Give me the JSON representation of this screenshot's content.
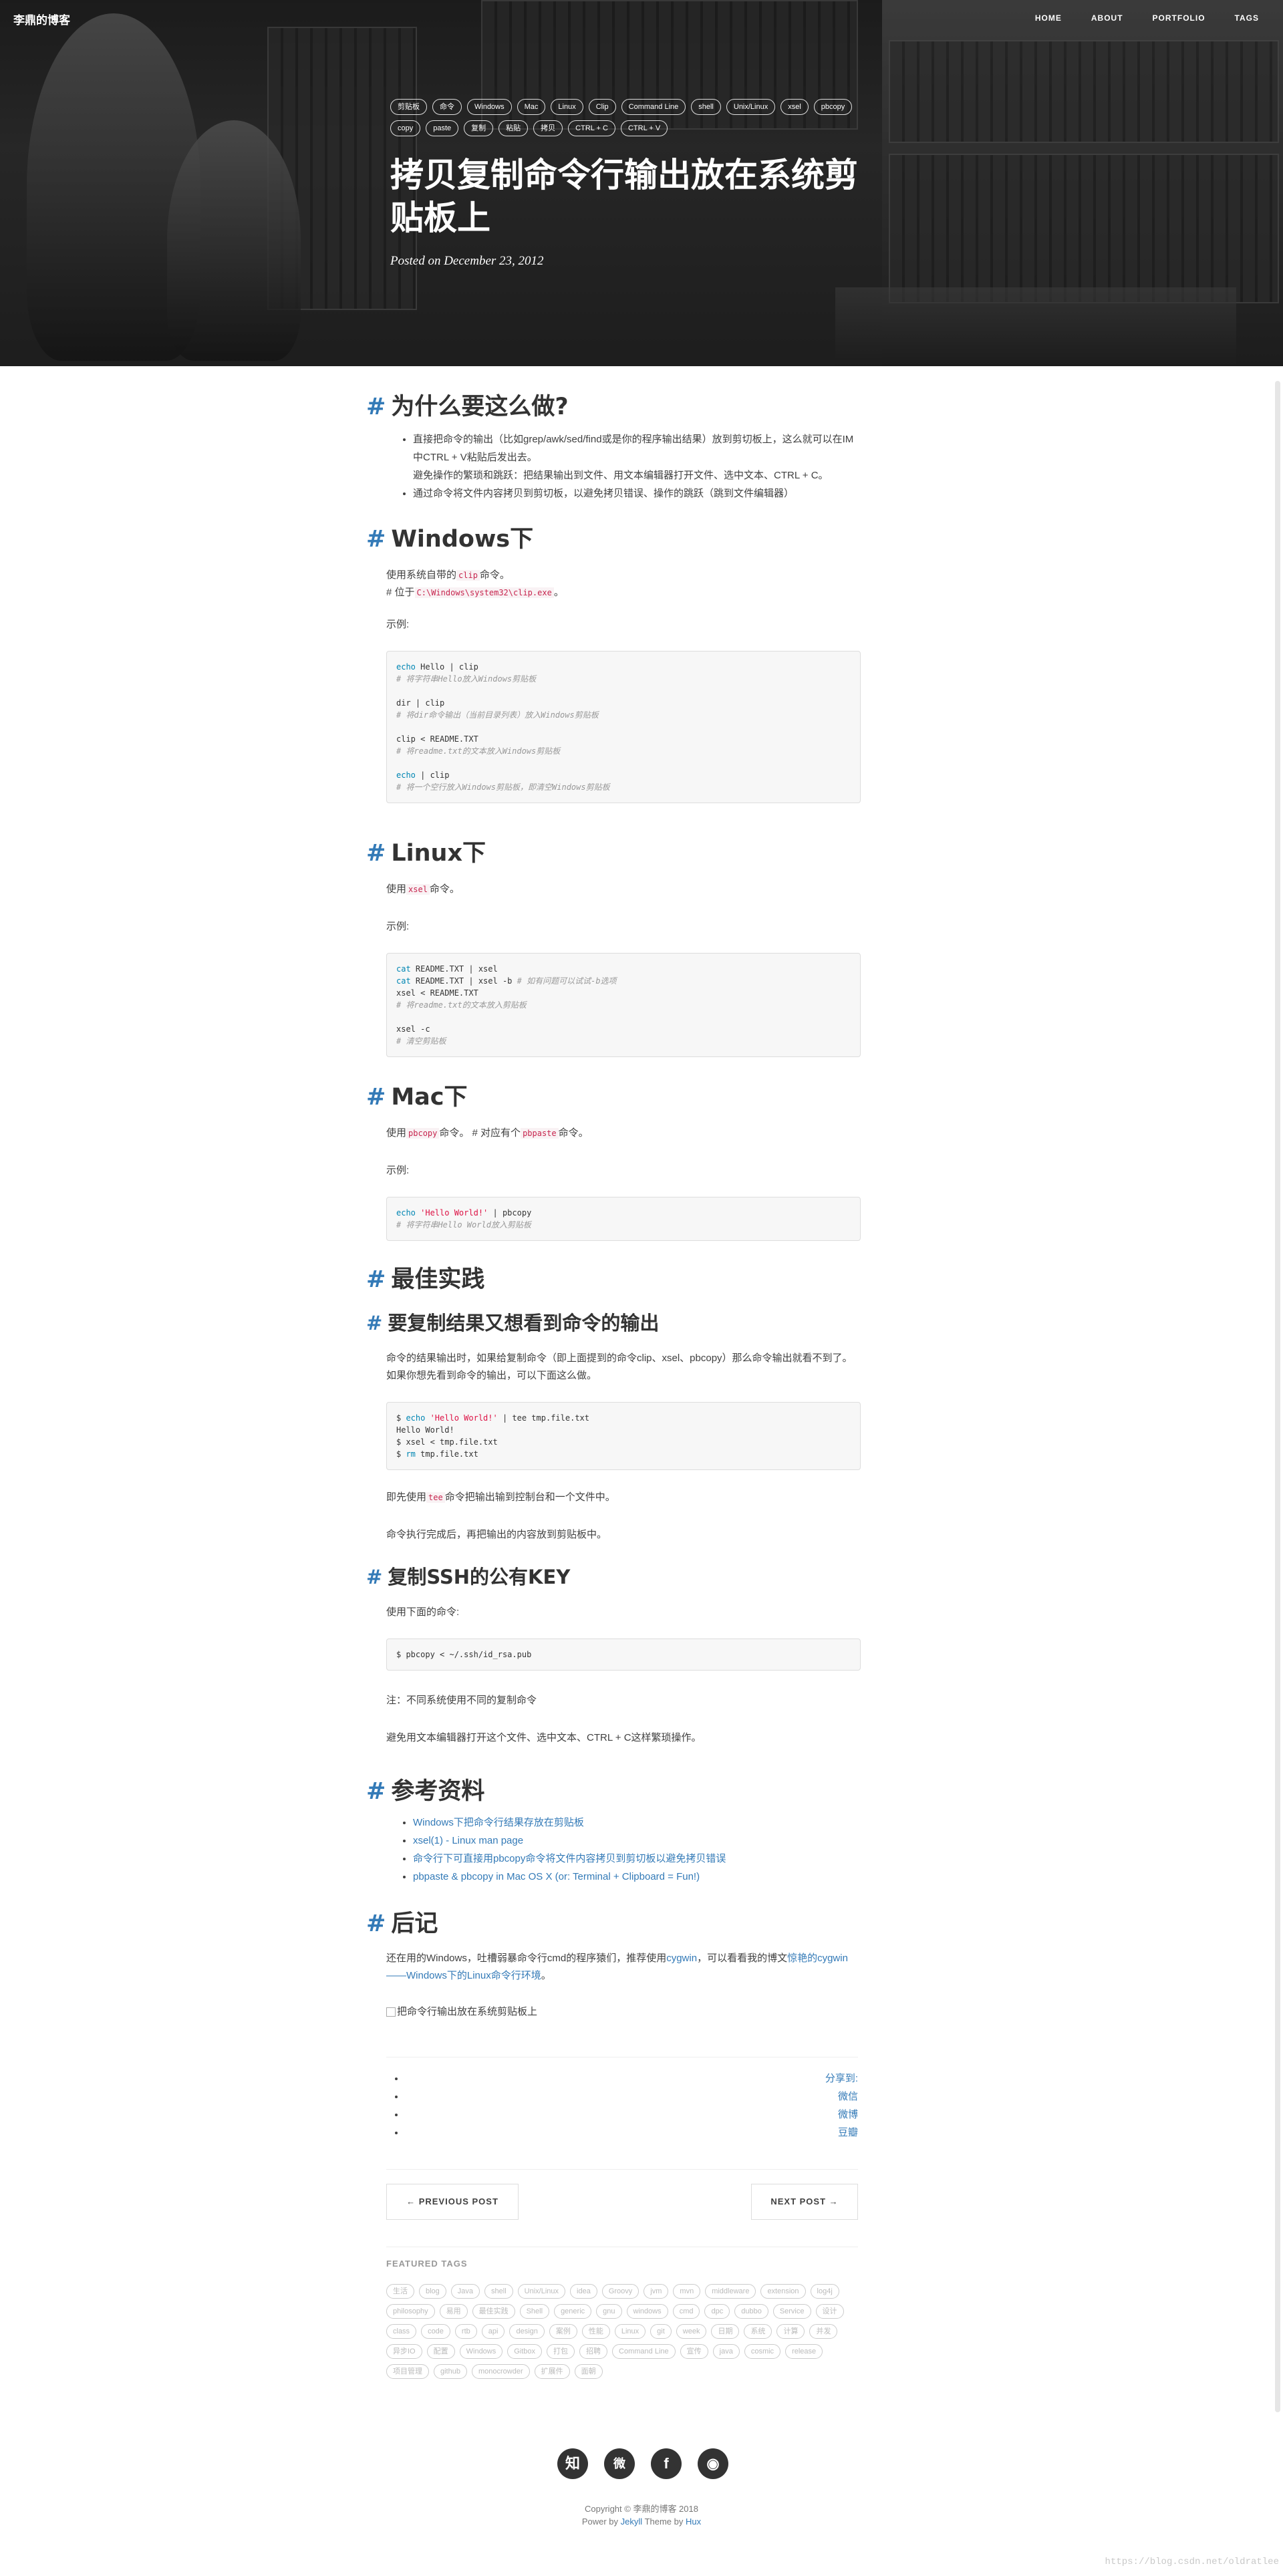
{
  "navbar": {
    "brand": "李鼎的博客",
    "links": [
      "HOME",
      "ABOUT",
      "PORTFOLIO",
      "TAGS"
    ]
  },
  "header": {
    "tags": [
      "剪贴板",
      "命令",
      "Windows",
      "Mac",
      "Linux",
      "Clip",
      "Command Line",
      "shell",
      "Unix/Linux",
      "xsel",
      "pbcopy",
      "copy",
      "paste",
      "复制",
      "粘贴",
      "拷贝",
      "CTRL + C",
      "CTRL + V"
    ],
    "title": "拷贝复制命令行输出放在系统剪贴板上",
    "meta": "Posted on December 23, 2012"
  },
  "why": {
    "heading": "为什么要这么做?",
    "b1": "直接把命令的输出（比如grep/awk/sed/find或是你的程序输出结果）放到剪切板上，这么就可以在IM中CTRL + V粘贴后发出去。",
    "b1b": "避免操作的繁琐和跳跃：把结果输出到文件、用文本编辑器打开文件、选中文本、CTRL + C。",
    "b2": "通过命令将文件内容拷贝到剪切板，以避免拷贝错误、操作的跳跃（跳到文件编辑器）"
  },
  "windows": {
    "heading": "Windows下",
    "p1a": "使用系统自带的",
    "p1code": "clip",
    "p1b": "命令。",
    "p2a": "# 位于",
    "p2code": "C:\\Windows\\system32\\clip.exe",
    "p2b": "。",
    "example": "示例:",
    "code": [
      {
        "k": "echo",
        "t": " Hello | clip"
      },
      {
        "c": "# 将字符串Hello放入Windows剪贴板"
      },
      {
        "t": ""
      },
      {
        "t": "dir | clip"
      },
      {
        "c": "# 将dir命令输出（当前目录列表）放入Windows剪贴板"
      },
      {
        "t": ""
      },
      {
        "t": "clip < README.TXT"
      },
      {
        "c": "# 将readme.txt的文本放入Windows剪贴板"
      },
      {
        "t": ""
      },
      {
        "k": "echo",
        "t": " | clip"
      },
      {
        "c": "# 将一个空行放入Windows剪贴板，即清空Windows剪贴板"
      }
    ]
  },
  "linux": {
    "heading": "Linux下",
    "p1a": "使用",
    "p1code": "xsel",
    "p1b": "命令。",
    "example": "示例:",
    "code": [
      {
        "k": "cat",
        "t": " README.TXT | xsel"
      },
      {
        "k": "cat",
        "t": " README.TXT | xsel -b ",
        "c": "# 如有问题可以试试-b选项"
      },
      {
        "t": "xsel < README.TXT"
      },
      {
        "c": "# 将readme.txt的文本放入剪贴板"
      },
      {
        "t": ""
      },
      {
        "t": "xsel -c"
      },
      {
        "c": "# 清空剪贴板"
      }
    ]
  },
  "mac": {
    "heading": "Mac下",
    "p1a": "使用",
    "p1code": "pbcopy",
    "p1b": "命令。 # 对应有个",
    "p1code2": "pbpaste",
    "p1c": "命令。",
    "example": "示例:",
    "code": [
      {
        "k": "echo",
        "s": " 'Hello World!'",
        "t": " | pbcopy"
      },
      {
        "c": "# 将字符串Hello World放入剪贴板"
      }
    ]
  },
  "best": {
    "heading": "最佳实践",
    "sub1": "要复制结果又想看到命令的输出",
    "p1": "命令的结果输出时，如果给复制命令（即上面提到的命令clip、xsel、pbcopy）那么命令输出就看不到了。如果你想先看到命令的输出，可以下面这么做。",
    "code": [
      {
        "t": "$ ",
        "k": "echo",
        "s": " 'Hello World!'",
        "t2": " | tee tmp.file.txt"
      },
      {
        "t": "Hello World!"
      },
      {
        "t": "$ xsel < tmp.file.txt"
      },
      {
        "t": "$ ",
        "k": "rm",
        "t2": " tmp.file.txt"
      }
    ],
    "p2a": "即先使用",
    "p2code": "tee",
    "p2b": "命令把输出输到控制台和一个文件中。",
    "p3": "命令执行完成后，再把输出的内容放到剪贴板中。",
    "sub2": "复制SSH的公有KEY",
    "p4": "使用下面的命令:",
    "code2": "$ pbcopy < ~/.ssh/id_rsa.pub",
    "p5": "注：不同系统使用不同的复制命令",
    "p6": "避免用文本编辑器打开这个文件、选中文本、CTRL + C这样繁琐操作。"
  },
  "refs": {
    "heading": "参考资料",
    "links": [
      "Windows下把命令行结果存放在剪贴板",
      "xsel(1) - Linux man page",
      "命令行下可直接用pbcopy命令将文件内容拷贝到剪切板以避免拷贝错误",
      "pbpaste & pbcopy in Mac OS X (or: Terminal + Clipboard = Fun!)"
    ]
  },
  "afterword": {
    "heading": "后记",
    "p1a": "还在用的Windows，吐槽弱暴命令行cmd的程序猿们，推荐使用",
    "p1link": "cygwin",
    "p1b": "，可以看看我的博文",
    "p1link2": "惊艳的cygwin——Windows下的Linux命令行环境",
    "p1c": "。",
    "img_alt": "把命令行输出放在系统剪贴板上"
  },
  "share": {
    "items": [
      "分享到:",
      "微信",
      "微博",
      "豆瓣"
    ]
  },
  "pager": {
    "prev": "← PREVIOUS POST",
    "next": "NEXT POST →"
  },
  "featured": {
    "title": "FEATURED TAGS",
    "tags": [
      "生活",
      "blog",
      "Java",
      "shell",
      "Unix/Linux",
      "idea",
      "Groovy",
      "jvm",
      "mvn",
      "middleware",
      "extension",
      "log4j",
      "philosophy",
      "易用",
      "最佳实践",
      "Shell",
      "generic",
      "gnu",
      "windows",
      "cmd",
      "dpc",
      "dubbo",
      "Service",
      "设计",
      "class",
      "code",
      "rtb",
      "api",
      "design",
      "案例",
      "性能",
      "Linux",
      "git",
      "week",
      "日期",
      "系统",
      "计算",
      "并发",
      "异步IO",
      "配置",
      "Windows",
      "Gitbox",
      "打包",
      "招聘",
      "Command Line",
      "宣传",
      "java",
      "cosmic",
      "release",
      "项目管理",
      "github",
      "monocrowder",
      "扩展件",
      "面朝"
    ]
  },
  "social": {
    "icons": [
      "知",
      "微",
      "f",
      "◉"
    ]
  },
  "footer": {
    "copyright": "Copyright © 李鼎的博客 2018",
    "power_a": "Power by",
    "power_link": "Jekyll",
    "power_b": "Theme by",
    "power_link2": "Hux"
  },
  "watermark": "https://blog.csdn.net/oldratlee"
}
